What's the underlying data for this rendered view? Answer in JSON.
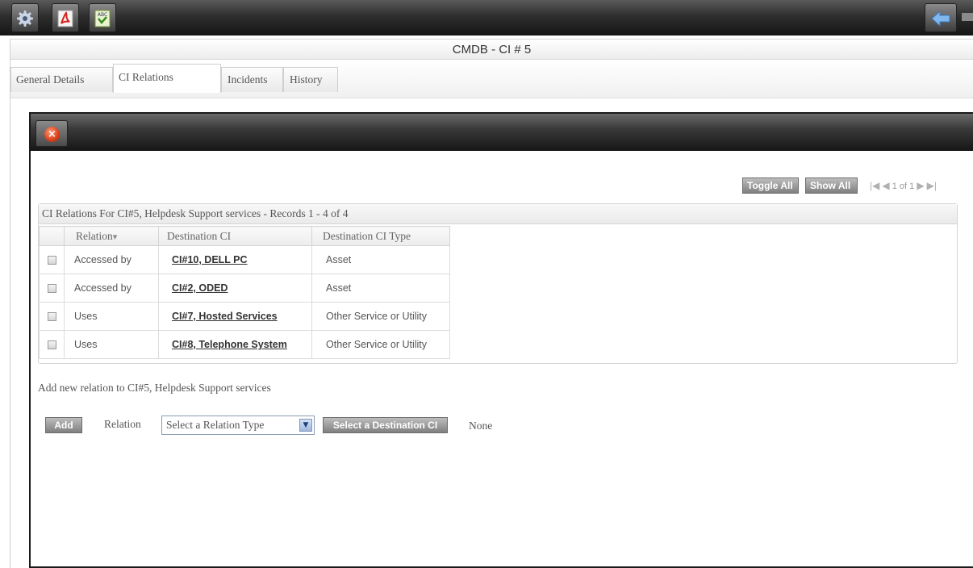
{
  "window": {
    "title": "CMDB - CI # 5"
  },
  "toolbar": {
    "icons": [
      "settings-icon",
      "pdf-icon",
      "spellcheck-icon",
      "back-arrow-icon"
    ],
    "spell_label": "ABC"
  },
  "tabs": [
    {
      "label": "General Details",
      "active": false
    },
    {
      "label": "CI Relations",
      "active": true
    },
    {
      "label": "Incidents",
      "active": false
    },
    {
      "label": "History",
      "active": false
    }
  ],
  "dialog": {
    "toggle_all_label": "Toggle All",
    "show_all_label": "Show All",
    "pager": {
      "text": "1 of 1"
    },
    "grid": {
      "caption": "CI Relations For CI#5, Helpdesk Support services - Records 1 - 4 of 4",
      "columns": [
        "Relation",
        "Destination CI",
        "Destination CI Type"
      ],
      "sort_indicator": "▾",
      "rows": [
        {
          "relation": "Accessed by",
          "destination": "CI#10, DELL PC",
          "type": "Asset"
        },
        {
          "relation": "Accessed by",
          "destination": "CI#2, ODED",
          "type": "Asset"
        },
        {
          "relation": "Uses",
          "destination": "CI#7, Hosted Services",
          "type": "Other Service or Utility"
        },
        {
          "relation": "Uses",
          "destination": "CI#8, Telephone System",
          "type": "Other Service or Utility"
        }
      ]
    },
    "add_section": {
      "title": "Add new relation to CI#5, Helpdesk Support services",
      "add_label": "Add",
      "relation_label": "Relation",
      "relation_select_value": "Select a Relation Type",
      "destination_button_label": "Select a Destination CI",
      "destination_value": "None"
    }
  },
  "colors": {
    "toolbar_dark": "#1e1e1e",
    "button_gray": "#8f8f8f",
    "link": "#333333"
  }
}
